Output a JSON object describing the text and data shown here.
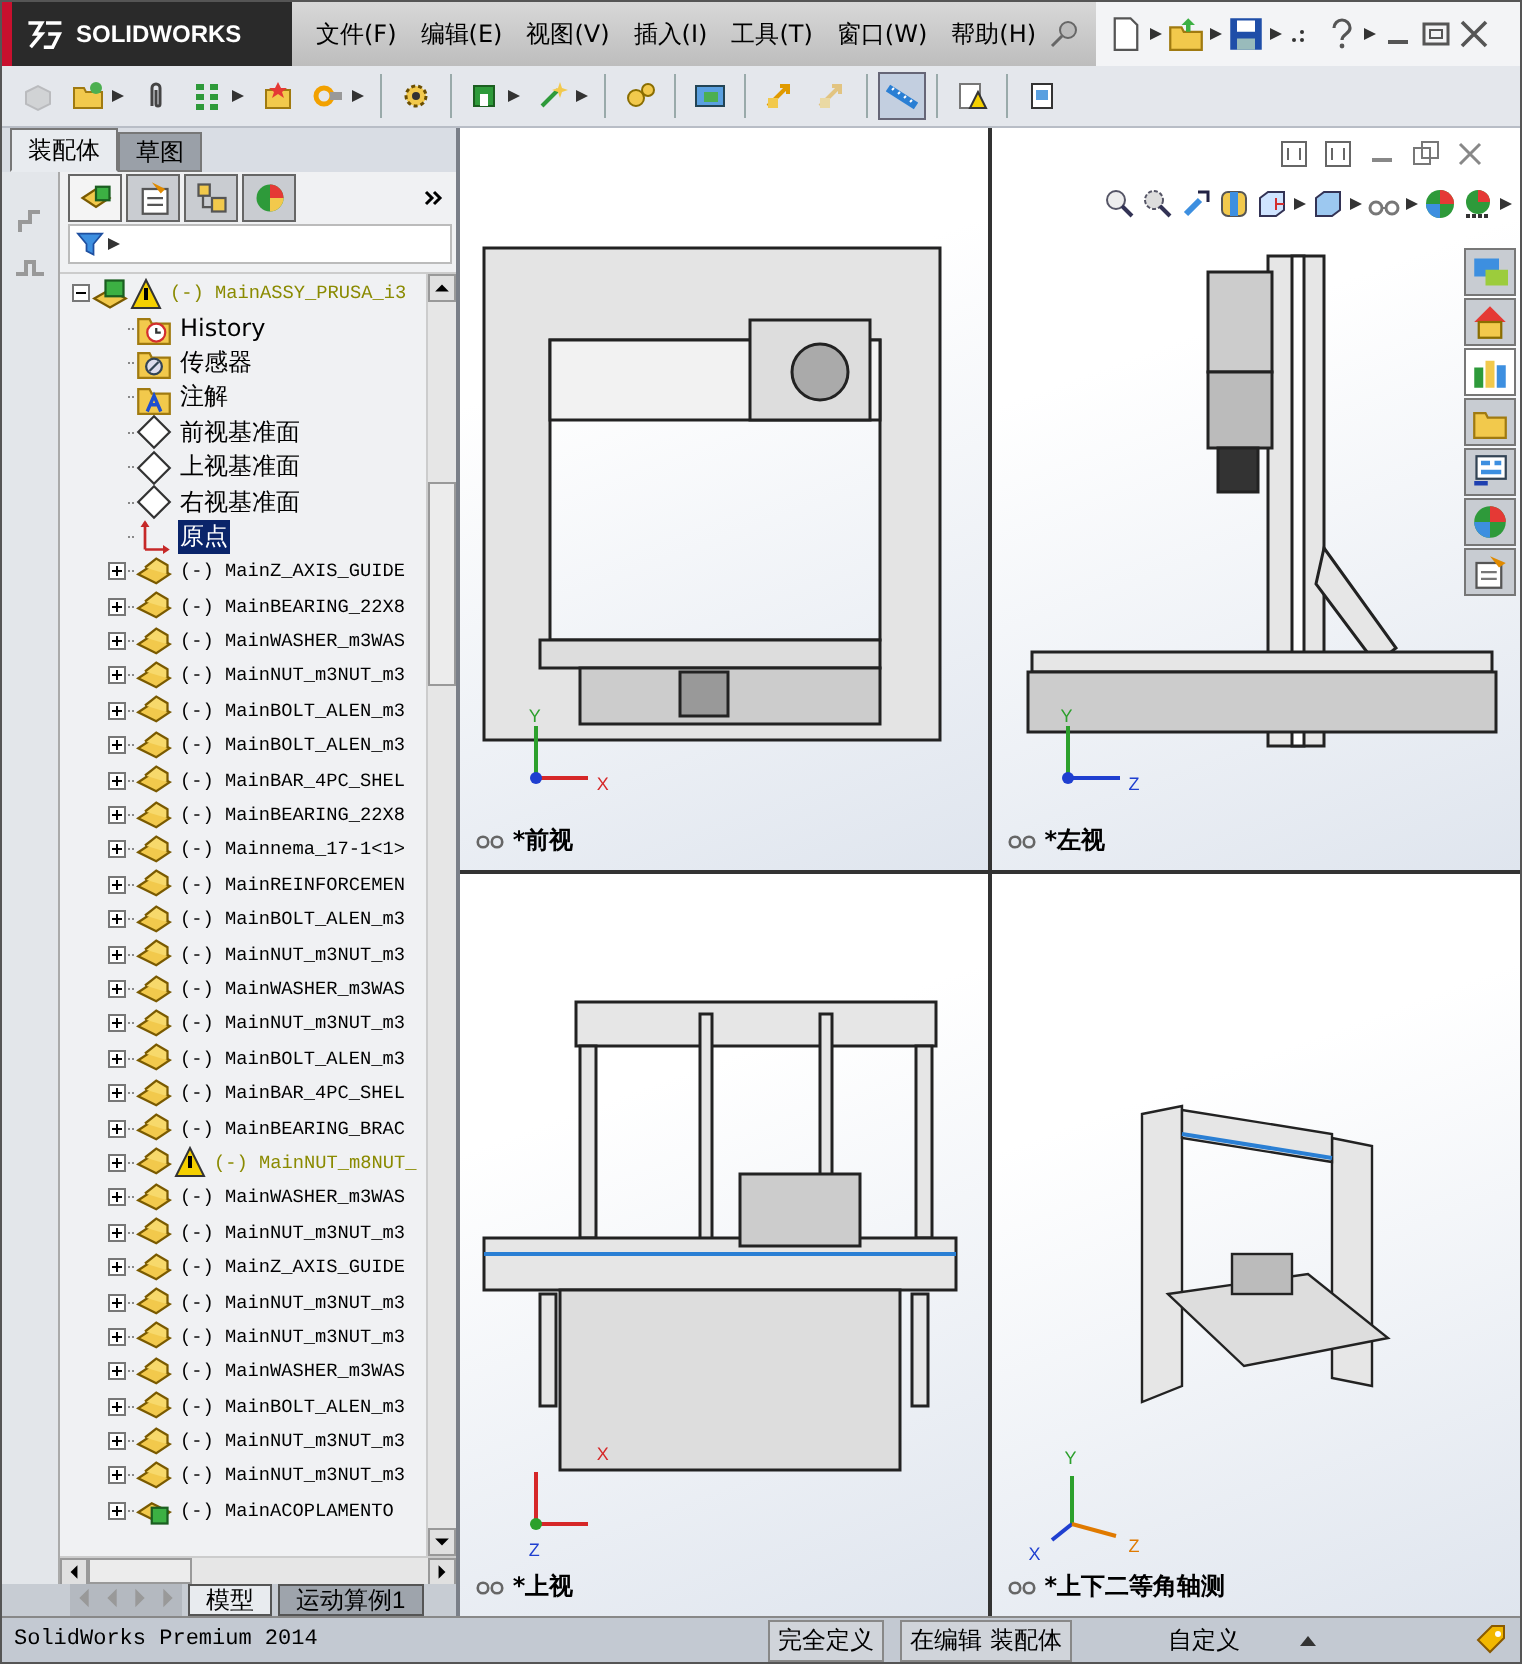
{
  "title_bar": {
    "logo": "SOLIDWORKS"
  },
  "menu": [
    "文件(F)",
    "编辑(E)",
    "视图(V)",
    "插入(I)",
    "工具(T)",
    "窗口(W)",
    "帮助(H)"
  ],
  "toolbar": [
    [
      {
        "kind": "part",
        "dropdown": false,
        "disabled": true,
        "pressed": false
      },
      {
        "kind": "folder",
        "dropdown": true,
        "disabled": false,
        "pressed": false
      },
      {
        "kind": "clip",
        "dropdown": false,
        "disabled": false,
        "pressed": false
      },
      {
        "kind": "grid",
        "dropdown": true,
        "disabled": false,
        "pressed": false
      },
      {
        "kind": "star",
        "dropdown": false,
        "disabled": false,
        "pressed": false
      },
      {
        "kind": "ring",
        "dropdown": true,
        "disabled": false,
        "pressed": false
      }
    ],
    [
      {
        "kind": "gearcar",
        "dropdown": false,
        "disabled": false,
        "pressed": false
      }
    ],
    [
      {
        "kind": "magnet",
        "dropdown": true,
        "disabled": false,
        "pressed": false
      },
      {
        "kind": "sparkle",
        "dropdown": true,
        "disabled": false,
        "pressed": false
      }
    ],
    [
      {
        "kind": "gears",
        "dropdown": false,
        "disabled": false,
        "pressed": false
      }
    ],
    [
      {
        "kind": "screen",
        "dropdown": false,
        "disabled": false,
        "pressed": false
      }
    ],
    [
      {
        "kind": "move",
        "dropdown": false,
        "disabled": false,
        "pressed": false
      },
      {
        "kind": "move",
        "dropdown": false,
        "disabled": true,
        "pressed": false
      }
    ],
    [
      {
        "kind": "ruler",
        "dropdown": false,
        "disabled": false,
        "pressed": true
      }
    ],
    [
      {
        "kind": "warning",
        "dropdown": false,
        "disabled": false,
        "pressed": false
      }
    ],
    [
      {
        "kind": "doc",
        "dropdown": false,
        "disabled": false,
        "pressed": false
      }
    ]
  ],
  "panel_tabs": [
    {
      "label": "装配体",
      "selected": true
    },
    {
      "label": "草图",
      "selected": false
    }
  ],
  "manager_tabs": [
    {
      "kind": "feature",
      "selected": true
    },
    {
      "kind": "property",
      "selected": false
    },
    {
      "kind": "config",
      "selected": false
    },
    {
      "kind": "display",
      "selected": false
    }
  ],
  "tree": {
    "label": "(-) MainASSY_PRUSA_i3",
    "kind": "assembly",
    "warning": true,
    "expanded": true,
    "selected": false,
    "children": [
      {
        "label": "History",
        "kind": "history",
        "warning": false,
        "selected": false
      },
      {
        "label": "传感器",
        "kind": "sensor",
        "warning": false,
        "selected": false
      },
      {
        "label": "注解",
        "kind": "annotation",
        "warning": false,
        "selected": false
      },
      {
        "label": "前视基准面",
        "kind": "plane",
        "warning": false,
        "selected": false
      },
      {
        "label": "上视基准面",
        "kind": "plane",
        "warning": false,
        "selected": false
      },
      {
        "label": "右视基准面",
        "kind": "plane",
        "warning": false,
        "selected": false
      },
      {
        "label": "原点",
        "kind": "origin",
        "warning": false,
        "selected": true
      },
      {
        "label": "(-) MainZ_AXIS_GUIDE",
        "kind": "part",
        "warning": false,
        "selected": false,
        "expanded": false
      },
      {
        "label": "(-) MainBEARING_22X8",
        "kind": "part",
        "warning": false,
        "selected": false,
        "expanded": false
      },
      {
        "label": "(-) MainWASHER_m3WAS",
        "kind": "part",
        "warning": false,
        "selected": false,
        "expanded": false
      },
      {
        "label": "(-) MainNUT_m3NUT_m3",
        "kind": "part",
        "warning": false,
        "selected": false,
        "expanded": false
      },
      {
        "label": "(-) MainBOLT_ALEN_m3",
        "kind": "part",
        "warning": false,
        "selected": false,
        "expanded": false
      },
      {
        "label": "(-) MainBOLT_ALEN_m3",
        "kind": "part",
        "warning": false,
        "selected": false,
        "expanded": false
      },
      {
        "label": "(-) MainBAR_4PC_SHEL",
        "kind": "part",
        "warning": false,
        "selected": false,
        "expanded": false
      },
      {
        "label": "(-) MainBEARING_22X8",
        "kind": "part",
        "warning": false,
        "selected": false,
        "expanded": false
      },
      {
        "label": "(-) Mainnema_17-1<1>",
        "kind": "part",
        "warning": false,
        "selected": false,
        "expanded": false
      },
      {
        "label": "(-) MainREINFORCEMEN",
        "kind": "part",
        "warning": false,
        "selected": false,
        "expanded": false
      },
      {
        "label": "(-) MainBOLT_ALEN_m3",
        "kind": "part",
        "warning": false,
        "selected": false,
        "expanded": false
      },
      {
        "label": "(-) MainNUT_m3NUT_m3",
        "kind": "part",
        "warning": false,
        "selected": false,
        "expanded": false
      },
      {
        "label": "(-) MainWASHER_m3WAS",
        "kind": "part",
        "warning": false,
        "selected": false,
        "expanded": false
      },
      {
        "label": "(-) MainNUT_m3NUT_m3",
        "kind": "part",
        "warning": false,
        "selected": false,
        "expanded": false
      },
      {
        "label": "(-) MainBOLT_ALEN_m3",
        "kind": "part",
        "warning": false,
        "selected": false,
        "expanded": false
      },
      {
        "label": "(-) MainBAR_4PC_SHEL",
        "kind": "part",
        "warning": false,
        "selected": false,
        "expanded": false
      },
      {
        "label": "(-) MainBEARING_BRAC",
        "kind": "part",
        "warning": false,
        "selected": false,
        "expanded": false
      },
      {
        "label": "(-) MainNUT_m8NUT_",
        "kind": "part",
        "warning": true,
        "selected": false,
        "expanded": false
      },
      {
        "label": "(-) MainWASHER_m3WAS",
        "kind": "part",
        "warning": false,
        "selected": false,
        "expanded": false
      },
      {
        "label": "(-) MainNUT_m3NUT_m3",
        "kind": "part",
        "warning": false,
        "selected": false,
        "expanded": false
      },
      {
        "label": "(-) MainZ_AXIS_GUIDE",
        "kind": "part",
        "warning": false,
        "selected": false,
        "expanded": false
      },
      {
        "label": "(-) MainNUT_m3NUT_m3",
        "kind": "part",
        "warning": false,
        "selected": false,
        "expanded": false
      },
      {
        "label": "(-) MainNUT_m3NUT_m3",
        "kind": "part",
        "warning": false,
        "selected": false,
        "expanded": false
      },
      {
        "label": "(-) MainWASHER_m3WAS",
        "kind": "part",
        "warning": false,
        "selected": false,
        "expanded": false
      },
      {
        "label": "(-) MainBOLT_ALEN_m3",
        "kind": "part",
        "warning": false,
        "selected": false,
        "expanded": false
      },
      {
        "label": "(-) MainNUT_m3NUT_m3",
        "kind": "part",
        "warning": false,
        "selected": false,
        "expanded": false
      },
      {
        "label": "(-) MainNUT_m3NUT_m3",
        "kind": "part",
        "warning": false,
        "selected": false,
        "expanded": false
      },
      {
        "label": "(-) MainACOPLAMENTO",
        "kind": "subassembly",
        "warning": false,
        "selected": false,
        "expanded": false
      }
    ]
  },
  "bottom_tabs": [
    {
      "label": "模型",
      "selected": true
    },
    {
      "label": "运动算例1",
      "selected": false
    }
  ],
  "viewports": [
    {
      "kind": "front",
      "label": "*前视",
      "axes": [
        "Y",
        "X"
      ]
    },
    {
      "kind": "left",
      "label": "*左视",
      "axes": [
        "Y",
        "Z"
      ]
    },
    {
      "kind": "top",
      "label": "*上视",
      "axes": [
        "X",
        "Z"
      ]
    },
    {
      "kind": "iso",
      "label": "*上下二等角轴测",
      "axes": [
        "Y",
        "X",
        "Z"
      ]
    }
  ],
  "task_pane": [
    {
      "kind": "chat",
      "selected": false
    },
    {
      "kind": "home",
      "selected": false
    },
    {
      "kind": "library",
      "selected": true
    },
    {
      "kind": "folder",
      "selected": false
    },
    {
      "kind": "palette",
      "selected": false
    },
    {
      "kind": "appearance",
      "selected": false
    },
    {
      "kind": "properties",
      "selected": false
    }
  ],
  "status_bar": {
    "product": "SolidWorks Premium 2014",
    "fields": [
      "完全定义",
      "在编辑 装配体",
      "自定义"
    ]
  }
}
